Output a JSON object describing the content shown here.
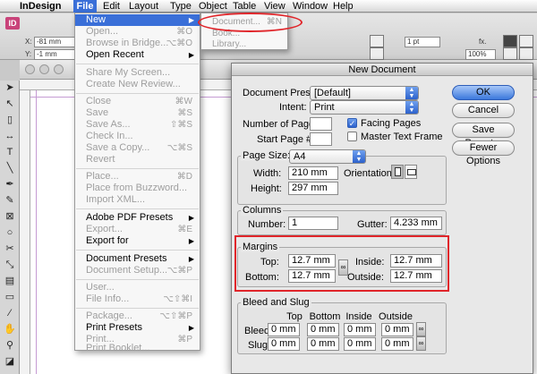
{
  "menubar": {
    "apple": "",
    "app": "InDesign",
    "items": [
      "File",
      "Edit",
      "Layout",
      "Type",
      "Object",
      "Table",
      "View",
      "Window",
      "Help"
    ]
  },
  "controlbar": {
    "x_label": "X:",
    "x_value": "-81 mm",
    "y_label": "Y:",
    "y_value": "-1 mm",
    "stroke_weight": "1 pt",
    "percent_value": "100%",
    "logo": "ID"
  },
  "file_menu": {
    "items": [
      {
        "label": "New",
        "shortcut": "",
        "submenu": true,
        "enabled": true,
        "highlighted": true
      },
      {
        "label": "Open...",
        "shortcut": "⌘O",
        "enabled": false
      },
      {
        "label": "Browse in Bridge...",
        "shortcut": "⌥⌘O",
        "enabled": false
      },
      {
        "label": "Open Recent",
        "shortcut": "",
        "submenu": true,
        "enabled": true
      },
      {
        "label": "Share My Screen...",
        "shortcut": "",
        "enabled": false
      },
      {
        "label": "Create New Review...",
        "shortcut": "",
        "enabled": false
      },
      {
        "label": "Close",
        "shortcut": "⌘W",
        "enabled": false
      },
      {
        "label": "Save",
        "shortcut": "⌘S",
        "enabled": false
      },
      {
        "label": "Save As...",
        "shortcut": "⇧⌘S",
        "enabled": false
      },
      {
        "label": "Check In...",
        "shortcut": "",
        "enabled": false
      },
      {
        "label": "Save a Copy...",
        "shortcut": "⌥⌘S",
        "enabled": false
      },
      {
        "label": "Revert",
        "shortcut": "",
        "enabled": false
      },
      {
        "label": "Place...",
        "shortcut": "⌘D",
        "enabled": false
      },
      {
        "label": "Place from Buzzword...",
        "shortcut": "",
        "enabled": false
      },
      {
        "label": "Import XML...",
        "shortcut": "",
        "enabled": false
      },
      {
        "label": "Adobe PDF Presets",
        "shortcut": "",
        "submenu": true,
        "enabled": true
      },
      {
        "label": "Export...",
        "shortcut": "⌘E",
        "enabled": false
      },
      {
        "label": "Export for",
        "shortcut": "",
        "submenu": true,
        "enabled": true
      },
      {
        "label": "Document Presets",
        "shortcut": "",
        "submenu": true,
        "enabled": true
      },
      {
        "label": "Document Setup...",
        "shortcut": "⌥⌘P",
        "enabled": false
      },
      {
        "label": "User...",
        "shortcut": "",
        "enabled": false
      },
      {
        "label": "File Info...",
        "shortcut": "⌥⇧⌘I",
        "enabled": false
      },
      {
        "label": "Package...",
        "shortcut": "⌥⇧⌘P",
        "enabled": false
      },
      {
        "label": "Print Presets",
        "shortcut": "",
        "submenu": true,
        "enabled": true
      },
      {
        "label": "Print...",
        "shortcut": "⌘P",
        "enabled": false
      },
      {
        "label": "Print Booklet...",
        "shortcut": "",
        "enabled": false
      }
    ]
  },
  "new_submenu": {
    "items": [
      {
        "label": "Document...",
        "shortcut": "⌘N"
      },
      {
        "label": "Book..."
      },
      {
        "label": "Library..."
      }
    ]
  },
  "dialog": {
    "title": "New Document",
    "preset_label": "Document Preset:",
    "preset_value": "[Default]",
    "intent_label": "Intent:",
    "intent_value": "Print",
    "num_pages_label": "Number of Pages:",
    "num_pages_value": "",
    "start_page_label": "Start Page #:",
    "start_page_value": "",
    "facing_pages_label": "Facing Pages",
    "facing_pages_checked": true,
    "master_text_label": "Master Text Frame",
    "master_text_checked": false,
    "page_size_group": "Page Size:",
    "page_size_value": "A4",
    "width_label": "Width:",
    "width_value": "210 mm",
    "height_label": "Height:",
    "height_value": "297 mm",
    "orientation_label": "Orientation:",
    "columns_group": "Columns",
    "number_label": "Number:",
    "number_value": "1",
    "gutter_label": "Gutter:",
    "gutter_value": "4.233 mm",
    "margins_group": "Margins",
    "top_label": "Top:",
    "top_value": "12.7 mm",
    "bottom_label": "Bottom:",
    "bottom_value": "12.7 mm",
    "inside_label": "Inside:",
    "inside_value": "12.7 mm",
    "outside_label": "Outside:",
    "outside_value": "12.7 mm",
    "bleed_group": "Bleed and Slug",
    "bleed_cols": [
      "Top",
      "Bottom",
      "Inside",
      "Outside"
    ],
    "bleed_label": "Bleed:",
    "bleed_values": [
      "0 mm",
      "0 mm",
      "0 mm",
      "0 mm"
    ],
    "slug_label": "Slug:",
    "slug_values": [
      "0 mm",
      "0 mm",
      "0 mm",
      "0 mm"
    ],
    "ok": "OK",
    "cancel": "Cancel",
    "save_preset": "Save Preset...",
    "fewer_options": "Fewer Options"
  },
  "colors": {
    "highlight": "#3a6fd8",
    "annotation_red": "#e0252a",
    "guide": "#c59bd3"
  }
}
